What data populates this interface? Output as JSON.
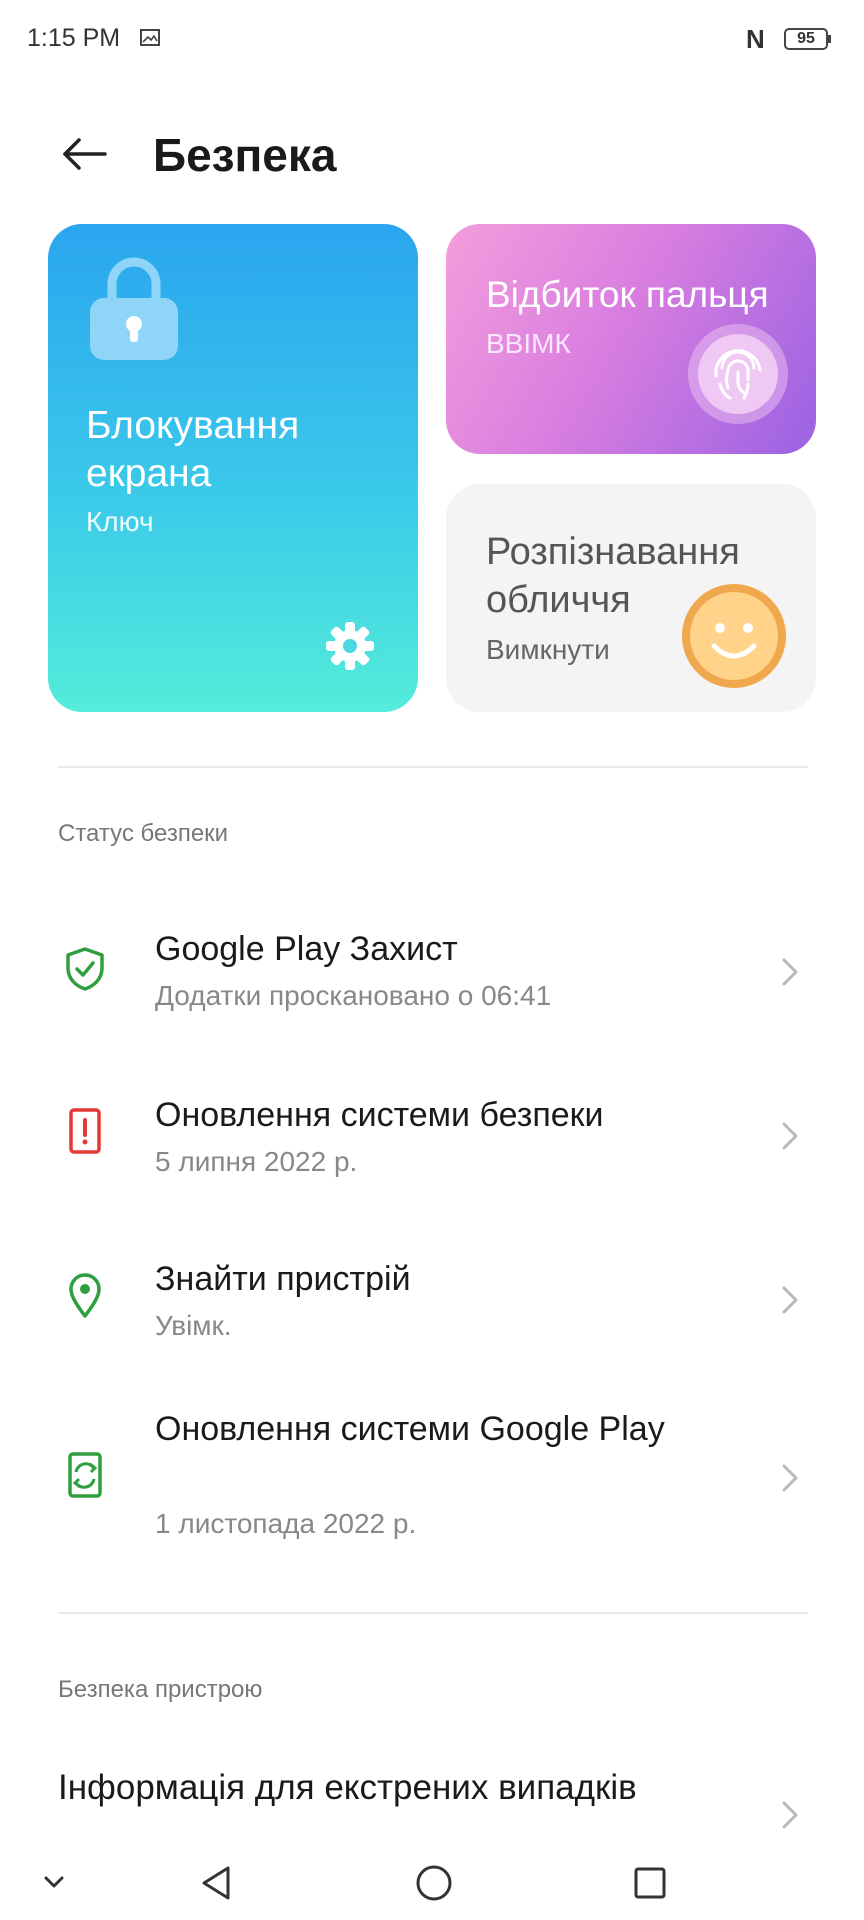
{
  "status_bar": {
    "time": "1:15 PM",
    "battery": "95",
    "nfc": "N"
  },
  "header": {
    "title": "Безпека"
  },
  "cards": {
    "lock": {
      "title": "Блокування екрана",
      "subtitle": "Ключ"
    },
    "fingerprint": {
      "title": "Відбиток пальця",
      "subtitle": "ВВІМК"
    },
    "face": {
      "title": "Розпізнавання обличчя",
      "subtitle": "Вимкнути"
    }
  },
  "sections": {
    "security_status": "Статус безпеки",
    "device_security": "Безпека пристрою"
  },
  "items": [
    {
      "title": "Google Play Захист",
      "subtitle": "Додатки проскановано о 06:41",
      "icon": "shield-check-icon",
      "color": "#2e9e3e"
    },
    {
      "title": "Оновлення системи безпеки",
      "subtitle": "5 липня 2022 р.",
      "icon": "phone-alert-icon",
      "color": "#e53935"
    },
    {
      "title": "Знайти пристрій",
      "subtitle": "Увімк.",
      "icon": "location-pin-icon",
      "color": "#2e9e3e"
    },
    {
      "title": "Оновлення системи Google Play",
      "subtitle": "1 листопада 2022 р.",
      "icon": "phone-sync-icon",
      "color": "#2e9e3e"
    }
  ],
  "emergency": {
    "title": "Інформація для екстрених випадків"
  },
  "colors": {
    "lock_gradient": [
      "#2aa5ef",
      "#54ecda"
    ],
    "finger_gradient": [
      "#f39edc",
      "#9a62e2"
    ],
    "face_card_bg": "#f4f4f4",
    "accent_green": "#2e9e3e",
    "alert_red": "#e53935"
  }
}
